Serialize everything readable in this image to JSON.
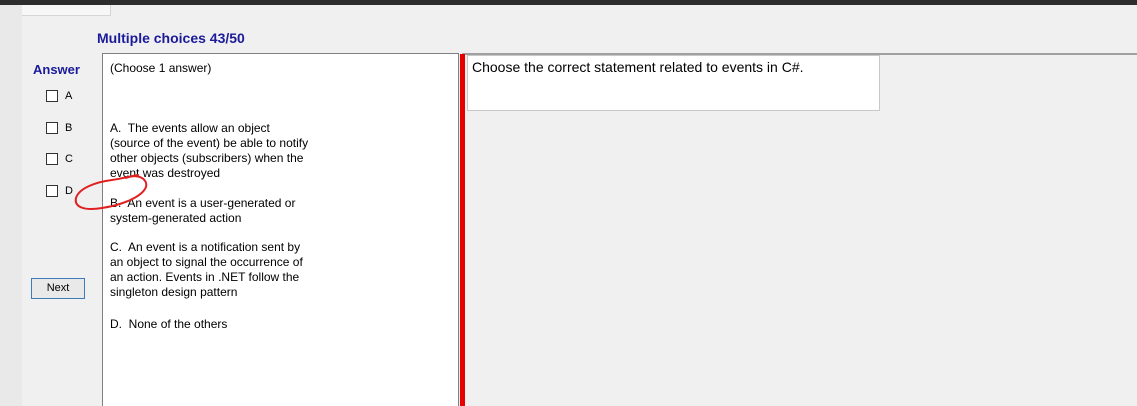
{
  "header": {
    "title": "Multiple choices 43/50"
  },
  "answer_area": {
    "label": "Answer",
    "options": [
      {
        "label": "A",
        "checked": false
      },
      {
        "label": "B",
        "checked": false
      },
      {
        "label": "C",
        "checked": false
      },
      {
        "label": "D",
        "checked": false
      }
    ],
    "next_label": "Next"
  },
  "choices_panel": {
    "instruction": "(Choose 1 answer)",
    "choices": [
      {
        "text": "A.  The events allow an object\n(source of the event) be able to notify\nother objects (subscribers) when the\nevent was destroyed"
      },
      {
        "text": "B.  An event is a user-generated or\nsystem-generated action"
      },
      {
        "text": "C.  An event is a notification sent by\nan object to signal the occurrence of\nan action. Events in .NET follow the\nsingleton design pattern"
      },
      {
        "text": "D.  None of the others"
      }
    ]
  },
  "question": {
    "text": "Choose the correct statement related to events in C#."
  },
  "annotation": {
    "color": "#e02020"
  }
}
